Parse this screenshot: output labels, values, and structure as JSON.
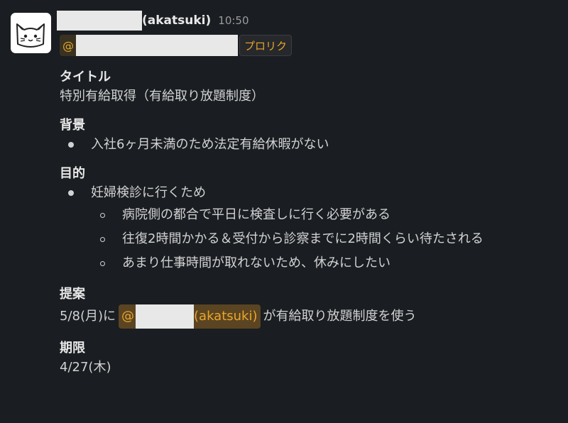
{
  "header": {
    "user_suffix": "(akatsuki)",
    "time": "10:50"
  },
  "mention": {
    "at": "@",
    "usergroup": "プロリク"
  },
  "sections": {
    "title": {
      "heading": "タイトル",
      "body": "特別有給取得（有給取り放題制度）"
    },
    "background": {
      "heading": "背景",
      "items": [
        "入社6ヶ月未満のため法定有給休暇がない"
      ]
    },
    "purpose": {
      "heading": "目的",
      "item": "妊婦検診に行くため",
      "subitems": [
        "病院側の都合で平日に検査しに行く必要がある",
        "往復2時間かかる＆受付から診察までに2時間くらい待たされる",
        "あまり仕事時間が取れないため、休みにしたい"
      ]
    },
    "proposal": {
      "heading": "提案",
      "prefix": "5/8(月)に",
      "mention_at": "@",
      "mention_suffix": "(akatsuki)",
      "suffix": "が有給取り放題制度を使う"
    },
    "deadline": {
      "heading": "期限",
      "body": "4/27(木)"
    }
  },
  "icons": {
    "avatar": "cat-avatar-icon"
  },
  "colors": {
    "background": "#1a1d21",
    "mention": "#e8a72b"
  }
}
